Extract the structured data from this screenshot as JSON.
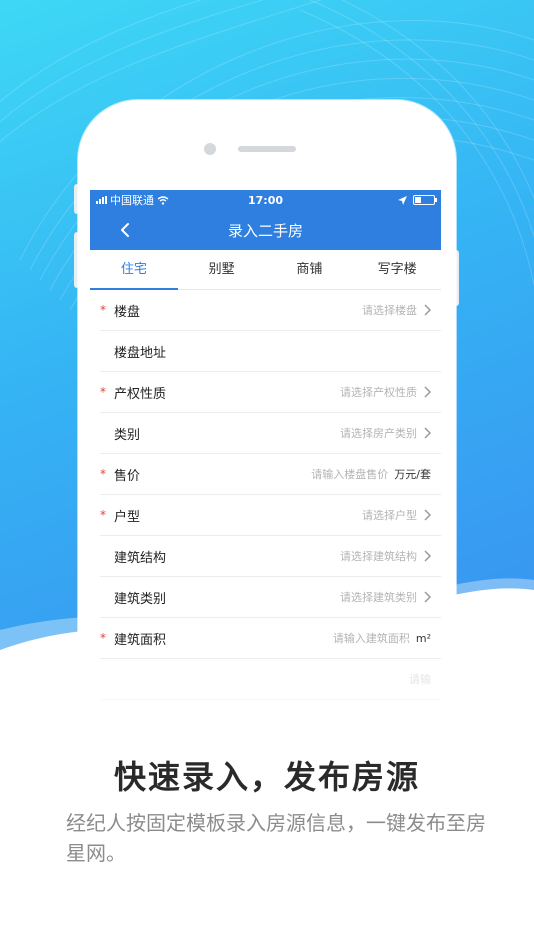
{
  "colors": {
    "accent": "#2f7fe0",
    "background_top": "#3ed8f5",
    "background_bottom": "#3a8ff0",
    "required": "#e0453a"
  },
  "status_bar": {
    "carrier": "中国联通",
    "time": "17:00",
    "icons": [
      "signal-icon",
      "wifi-icon",
      "location-icon",
      "battery-icon"
    ]
  },
  "nav": {
    "title": "录入二手房",
    "back_icon": "chevron-left-icon"
  },
  "tabs": [
    {
      "label": "住宅",
      "active": true
    },
    {
      "label": "别墅",
      "active": false
    },
    {
      "label": "商铺",
      "active": false
    },
    {
      "label": "写字楼",
      "active": false
    }
  ],
  "form": {
    "rows": [
      {
        "required": true,
        "label": "楼盘",
        "placeholder": "请选择楼盘",
        "unit": "",
        "chevron": true
      },
      {
        "required": false,
        "label": "楼盘地址",
        "placeholder": "",
        "unit": "",
        "chevron": false
      },
      {
        "required": true,
        "label": "产权性质",
        "placeholder": "请选择产权性质",
        "unit": "",
        "chevron": true
      },
      {
        "required": false,
        "label": "类别",
        "placeholder": "请选择房产类别",
        "unit": "",
        "chevron": true
      },
      {
        "required": true,
        "label": "售价",
        "placeholder": "请输入楼盘售价",
        "unit": "万元/套",
        "chevron": false
      },
      {
        "required": true,
        "label": "户型",
        "placeholder": "请选择户型",
        "unit": "",
        "chevron": true
      },
      {
        "required": false,
        "label": "建筑结构",
        "placeholder": "请选择建筑结构",
        "unit": "",
        "chevron": true
      },
      {
        "required": false,
        "label": "建筑类别",
        "placeholder": "请选择建筑类别",
        "unit": "",
        "chevron": true
      },
      {
        "required": true,
        "label": "建筑面积",
        "placeholder": "请输入建筑面积",
        "unit": "m²",
        "chevron": false
      },
      {
        "required": false,
        "label": "",
        "placeholder": "请输",
        "unit": "",
        "chevron": false
      }
    ],
    "required_mark": "*"
  },
  "promo": {
    "headline": "快速录入，发布房源",
    "description": "经纪人按固定模板录入房源信息，一键发布至房星网。"
  }
}
